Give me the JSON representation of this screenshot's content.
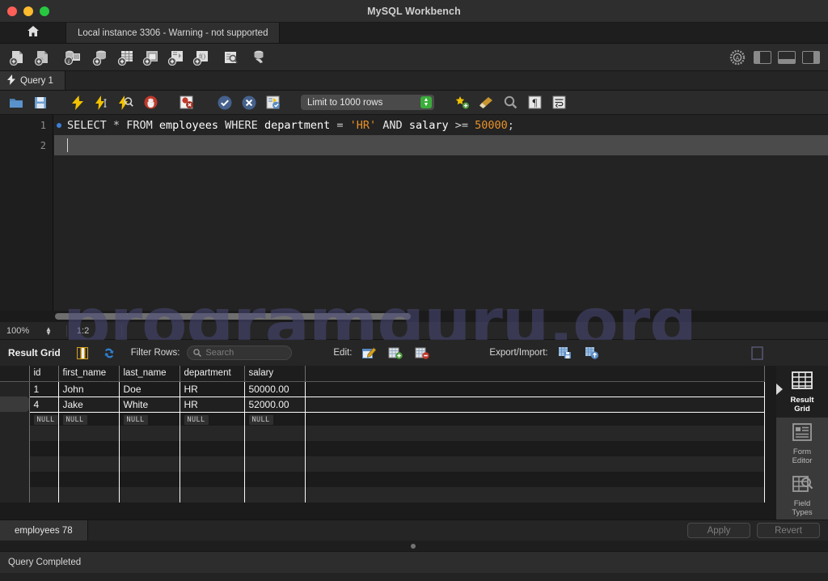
{
  "window": {
    "title": "MySQL Workbench",
    "traffic_lights": [
      "close",
      "minimize",
      "maximize"
    ]
  },
  "connection_bar": {
    "home_icon": "home-icon",
    "tab_label": "Local instance 3306 - Warning - not supported"
  },
  "main_toolbar": {
    "icons": [
      "new-sql-file-icon",
      "open-sql-file-icon",
      "server-info-icon",
      "new-schema-icon",
      "new-table-icon",
      "new-view-icon",
      "new-procedure-icon",
      "new-function-icon",
      "inspect-table-icon",
      "query-data-icon"
    ],
    "right_icons": [
      "settings-gear-icon",
      "toggle-left-panel-icon",
      "toggle-bottom-panel-icon",
      "toggle-right-panel-icon"
    ]
  },
  "query_tab": {
    "icon": "lightning-icon",
    "label": "Query 1"
  },
  "editor_toolbar": {
    "icons": [
      "open-file-icon",
      "save-file-icon",
      "execute-icon",
      "execute-current-icon",
      "explain-icon",
      "stop-icon",
      "stop-on-error-icon",
      "commit-icon",
      "rollback-icon",
      "autocommit-icon"
    ],
    "limit_label": "Limit to 1000 rows",
    "trailing_icons": [
      "beautify-icon",
      "clear-icon",
      "find-icon",
      "invisible-chars-icon",
      "wrap-lines-icon"
    ]
  },
  "editor": {
    "lines": [
      {
        "number": "1",
        "has_breakpoint_dot": true,
        "tokens": [
          {
            "t": "SELECT",
            "c": "kw"
          },
          {
            "t": " ",
            "c": "op"
          },
          {
            "t": "*",
            "c": "op"
          },
          {
            "t": " ",
            "c": "op"
          },
          {
            "t": "FROM",
            "c": "kw"
          },
          {
            "t": " ",
            "c": "op"
          },
          {
            "t": "employees",
            "c": "ident"
          },
          {
            "t": " ",
            "c": "op"
          },
          {
            "t": "WHERE",
            "c": "kw"
          },
          {
            "t": " ",
            "c": "op"
          },
          {
            "t": "department",
            "c": "ident"
          },
          {
            "t": " ",
            "c": "op"
          },
          {
            "t": "=",
            "c": "op"
          },
          {
            "t": " ",
            "c": "op"
          },
          {
            "t": "'HR'",
            "c": "str"
          },
          {
            "t": " ",
            "c": "op"
          },
          {
            "t": "AND",
            "c": "kw"
          },
          {
            "t": " ",
            "c": "op"
          },
          {
            "t": "salary",
            "c": "ident"
          },
          {
            "t": " ",
            "c": "op"
          },
          {
            "t": ">=",
            "c": "op"
          },
          {
            "t": " ",
            "c": "op"
          },
          {
            "t": "50000",
            "c": "num"
          },
          {
            "t": ";",
            "c": "op"
          }
        ]
      },
      {
        "number": "2",
        "has_breakpoint_dot": false,
        "tokens": []
      }
    ],
    "full_text": "SELECT * FROM employees WHERE department = 'HR' AND salary >= 50000;"
  },
  "zoom_bar": {
    "zoom_level": "100%",
    "cursor_position": "1:2"
  },
  "result_toolbar": {
    "title": "Result Grid",
    "grid_view_icon": "grid-view-icon",
    "refresh_icon": "refresh-icon",
    "filter_label": "Filter Rows:",
    "search_placeholder": "Search",
    "search_value": "",
    "edit_label": "Edit:",
    "edit_icons": [
      "edit-row-icon",
      "insert-row-icon",
      "delete-row-icon"
    ],
    "export_label": "Export/Import:",
    "export_icons": [
      "export-recordset-icon",
      "import-recordset-icon"
    ],
    "wrap_cell_icon": "wrap-cell-content-icon"
  },
  "result_grid": {
    "columns": [
      "id",
      "first_name",
      "last_name",
      "department",
      "salary"
    ],
    "rows": [
      {
        "id": "1",
        "first_name": "John",
        "last_name": "Doe",
        "department": "HR",
        "salary": "50000.00",
        "selected": false
      },
      {
        "id": "4",
        "first_name": "Jake",
        "last_name": "White",
        "department": "HR",
        "salary": "52000.00",
        "selected": true
      }
    ],
    "null_placeholder": "NULL",
    "empty_row_count": 5
  },
  "side_panel": {
    "items": [
      {
        "label": "Result\nGrid",
        "icon": "result-grid-icon",
        "active": true
      },
      {
        "label": "Form\nEditor",
        "icon": "form-editor-icon",
        "active": false
      },
      {
        "label": "Field\nTypes",
        "icon": "field-types-icon",
        "active": false
      }
    ],
    "more_icon": "chevron-down-icon"
  },
  "bottom_bar": {
    "tab_label": "employees 78",
    "apply_label": "Apply",
    "revert_label": "Revert"
  },
  "statusbar": {
    "message": "Query Completed"
  },
  "watermark": {
    "text": "programguru.org",
    "color": "#4b4a7a"
  },
  "colors": {
    "accent_string": "#e8912a",
    "accent_number": "#e8912a",
    "window_bg": "#232323",
    "toolbar_bg": "#2b2b2b",
    "grid_bg": "#1b1b1b"
  }
}
